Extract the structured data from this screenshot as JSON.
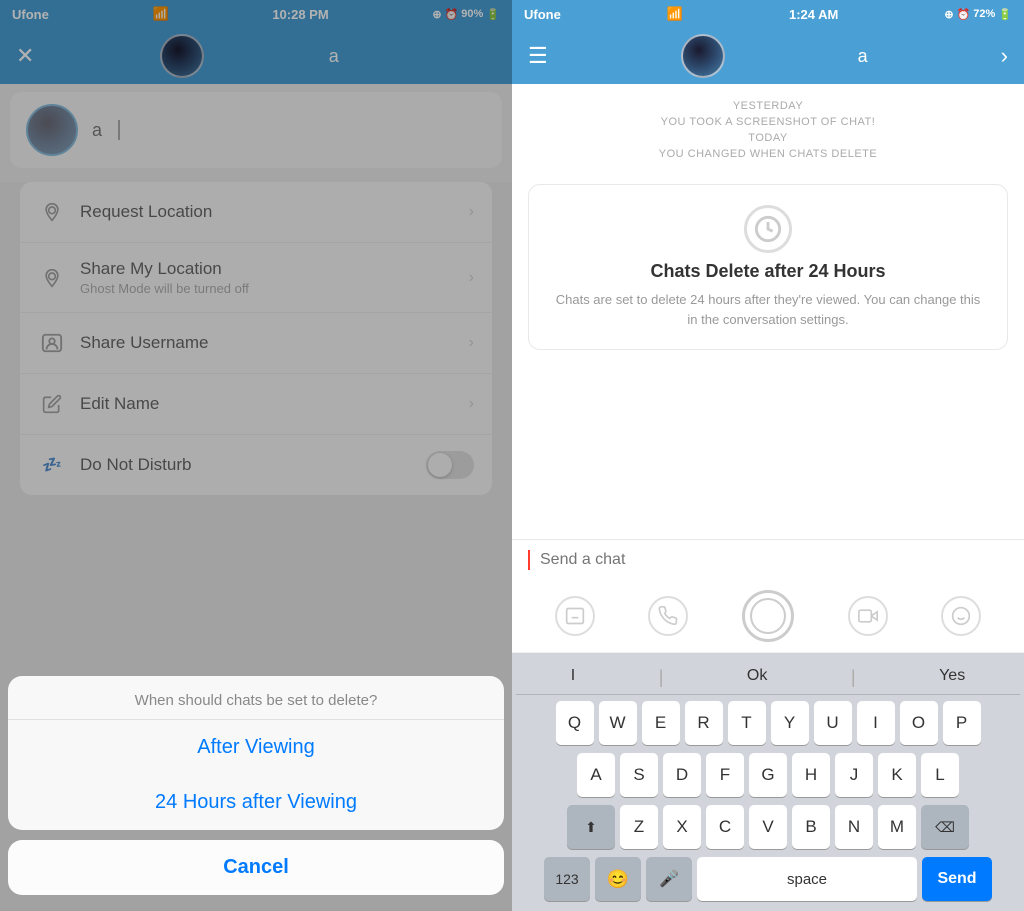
{
  "left": {
    "status_bar": {
      "carrier": "Ufone",
      "time": "10:28 PM",
      "battery": "90%"
    },
    "nav": {
      "username": "a",
      "close_label": "✕"
    },
    "chat_user": {
      "name": "a"
    },
    "menu_items": [
      {
        "id": "request-location",
        "icon": "📍",
        "title": "Request Location",
        "subtitle": "",
        "type": "chevron"
      },
      {
        "id": "share-my-location",
        "icon": "📍",
        "title": "Share My Location",
        "subtitle": "Ghost Mode will be turned off",
        "type": "chevron"
      },
      {
        "id": "share-username",
        "icon": "👻",
        "title": "Share Username",
        "subtitle": "",
        "type": "chevron"
      },
      {
        "id": "edit-name",
        "icon": "🖊",
        "title": "Edit Name",
        "subtitle": "",
        "type": "chevron"
      },
      {
        "id": "do-not-disturb",
        "icon": "💤",
        "title": "Do Not Disturb",
        "subtitle": "",
        "type": "toggle"
      }
    ],
    "action_sheet": {
      "title": "When should chats be set to delete?",
      "options": [
        "After Viewing",
        "24 Hours after Viewing"
      ],
      "cancel": "Cancel"
    }
  },
  "right": {
    "status_bar": {
      "carrier": "Ufone",
      "time": "1:24 AM",
      "battery": "72%"
    },
    "nav": {
      "username": "a"
    },
    "system_messages": [
      "YESTERDAY",
      "YOU TOOK A SCREENSHOT OF CHAT!",
      "TODAY",
      "YOU CHANGED WHEN CHATS DELETE"
    ],
    "delete_card": {
      "title": "Chats Delete after 24 Hours",
      "description": "Chats are set to delete 24 hours after they're viewed. You can change this in the conversation settings."
    },
    "chat_input": {
      "placeholder": "Send a chat"
    },
    "keyboard": {
      "suggestions": [
        "I",
        "Ok",
        "Yes"
      ],
      "rows": [
        [
          "Q",
          "W",
          "E",
          "R",
          "T",
          "Y",
          "U",
          "I",
          "O",
          "P"
        ],
        [
          "A",
          "S",
          "D",
          "F",
          "G",
          "H",
          "J",
          "K",
          "L"
        ],
        [
          "Z",
          "X",
          "C",
          "V",
          "B",
          "N",
          "M"
        ]
      ],
      "space_label": "space",
      "send_label": "Send",
      "num_label": "123",
      "delete_label": "⌫"
    }
  }
}
